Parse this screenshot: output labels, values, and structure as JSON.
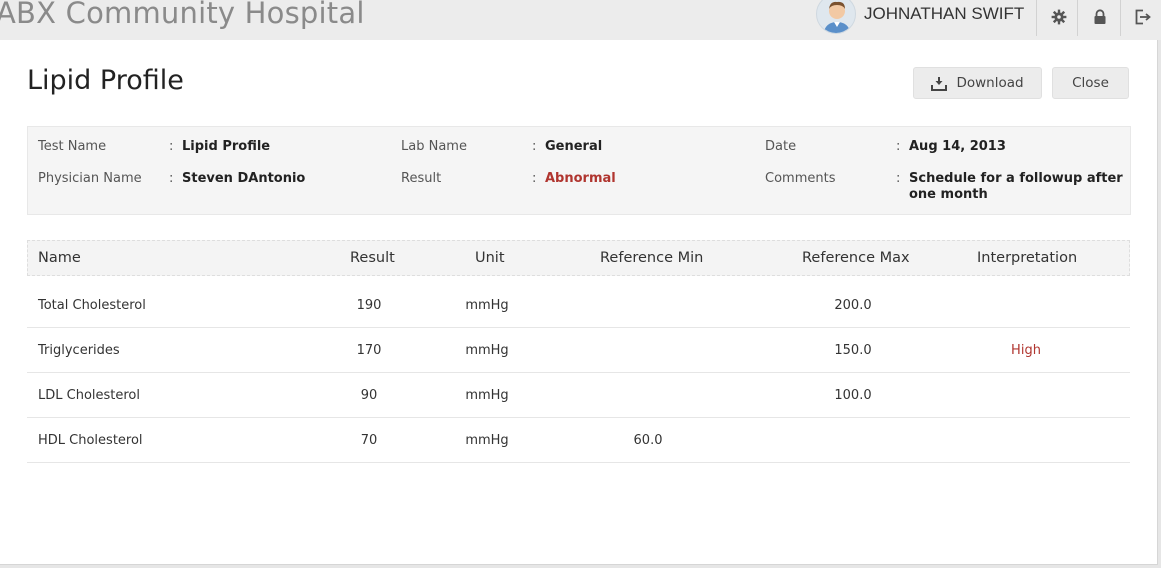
{
  "app": {
    "hospital_name": "ABX Community Hospital",
    "user_name": "JOHNATHAN SWIFT"
  },
  "page": {
    "title": "Lipid Profile",
    "download_label": "Download",
    "close_label": "Close"
  },
  "info": {
    "test_name_label": "Test Name",
    "test_name_value": "Lipid Profile",
    "physician_label": "Physician Name",
    "physician_value": "Steven DAntonio",
    "lab_name_label": "Lab Name",
    "lab_name_value": "General",
    "result_label": "Result",
    "result_value": "Abnormal",
    "date_label": "Date",
    "date_value": "Aug 14, 2013",
    "comments_label": "Comments",
    "comments_line1": "Schedule for a followup after",
    "comments_line2": "one month",
    "separator": ":"
  },
  "table": {
    "headers": {
      "name": "Name",
      "result": "Result",
      "unit": "Unit",
      "ref_min": "Reference Min",
      "ref_max": "Reference Max",
      "interpretation": "Interpretation"
    },
    "rows": [
      {
        "name": "Total Cholesterol",
        "result": "190",
        "unit": "mmHg",
        "ref_min": "",
        "ref_max": "200.0",
        "interpretation": ""
      },
      {
        "name": "Triglycerides",
        "result": "170",
        "unit": "mmHg",
        "ref_min": "",
        "ref_max": "150.0",
        "interpretation": "High"
      },
      {
        "name": "LDL Cholesterol",
        "result": "90",
        "unit": "mmHg",
        "ref_min": "",
        "ref_max": "100.0",
        "interpretation": ""
      },
      {
        "name": "HDL Cholesterol",
        "result": "70",
        "unit": "mmHg",
        "ref_min": "60.0",
        "ref_max": "",
        "interpretation": ""
      }
    ]
  },
  "icons": {
    "settings": "gear-icon",
    "lock": "lock-icon",
    "logout": "logout-icon",
    "download": "download-icon",
    "avatar": "user-avatar"
  },
  "colors": {
    "abnormal": "#b0352f",
    "high": "#b0352f"
  }
}
